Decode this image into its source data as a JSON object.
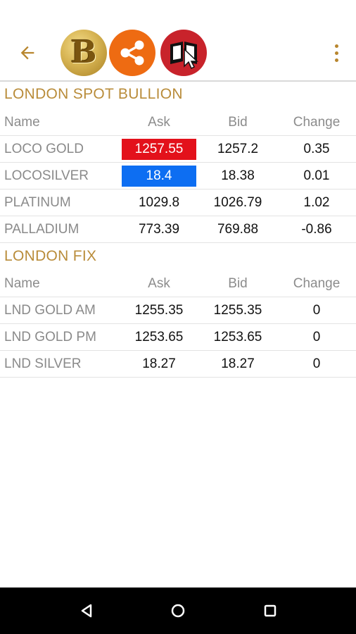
{
  "colors": {
    "accent_gold": "#b98c3a",
    "ask_up": "#e3111b",
    "ask_down": "#0d6ef2",
    "share_orange": "#ee6b12",
    "book_red": "#c8232b"
  },
  "app_bar": {
    "back_icon": "arrow-left-icon",
    "brand_letter": "B",
    "share_icon": "share-icon",
    "book_icon": "book-cursor-icon",
    "menu_icon": "more-vert-icon"
  },
  "columns": {
    "name": "Name",
    "ask": "Ask",
    "bid": "Bid",
    "change": "Change"
  },
  "spot": {
    "title": "LONDON SPOT BULLION",
    "rows": [
      {
        "name": "LOCO GOLD",
        "ask": "1257.55",
        "bid": "1257.2",
        "change": "0.35",
        "highlight": "red"
      },
      {
        "name": "LOCOSILVER",
        "ask": "18.4",
        "bid": "18.38",
        "change": "0.01",
        "highlight": "blue"
      },
      {
        "name": "PLATINUM",
        "ask": "1029.8",
        "bid": "1026.79",
        "change": "1.02",
        "highlight": ""
      },
      {
        "name": "PALLADIUM",
        "ask": "773.39",
        "bid": "769.88",
        "change": "-0.86",
        "highlight": ""
      }
    ]
  },
  "fix": {
    "title": "LONDON FIX",
    "rows": [
      {
        "name": "LND GOLD AM",
        "ask": "1255.35",
        "bid": "1255.35",
        "change": "0"
      },
      {
        "name": "LND GOLD PM",
        "ask": "1253.65",
        "bid": "1253.65",
        "change": "0"
      },
      {
        "name": "LND SILVER",
        "ask": "18.27",
        "bid": "18.27",
        "change": "0"
      }
    ]
  },
  "nav_bar": {
    "back_icon": "nav-back-icon",
    "home_icon": "nav-home-icon",
    "recents_icon": "nav-recents-icon"
  }
}
